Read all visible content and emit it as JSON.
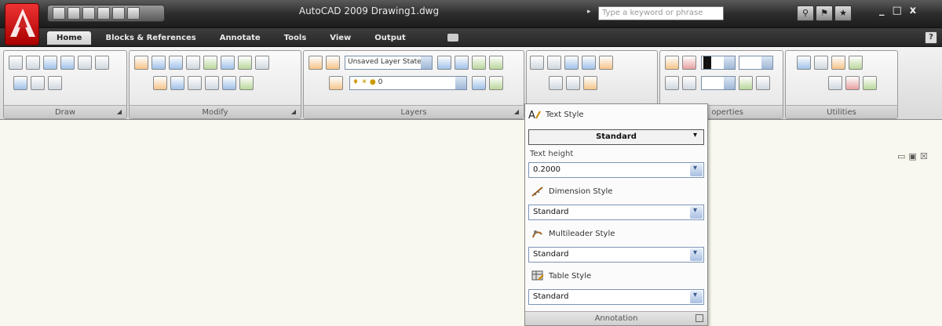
{
  "title_bar": {
    "title": "AutoCAD 2009  Drawing1.dwg",
    "search_placeholder": "Type a keyword or phrase",
    "window_controls": [
      "_",
      "□",
      "x"
    ]
  },
  "tabs": [
    {
      "label": "Home",
      "active": true
    },
    {
      "label": "Blocks & References",
      "active": false
    },
    {
      "label": "Annotate",
      "active": false
    },
    {
      "label": "Tools",
      "active": false
    },
    {
      "label": "View",
      "active": false
    },
    {
      "label": "Output",
      "active": false
    }
  ],
  "help_label": "?",
  "panels": {
    "draw": "Draw",
    "modify": "Modify",
    "layers": "Layers",
    "properties": "operties",
    "utilities": "Utilities"
  },
  "layers": {
    "layer_dropdown": "Unsaved Layer State",
    "layer_current": "0"
  },
  "annotation": {
    "text_style_label": "Text Style",
    "text_style_value": "Standard",
    "text_height_label": "Text height",
    "text_height_value": "0.2000",
    "dimension_style_label": "Dimension Style",
    "dimension_style_value": "Standard",
    "multileader_style_label": "Multileader Style",
    "multileader_style_value": "Standard",
    "table_style_label": "Table Style",
    "table_style_value": "Standard",
    "footer": "Annotation"
  },
  "colors": {
    "title_bar": "#2d2d2d",
    "canvas": "#f9f8ee",
    "app_logo": "#cc2222"
  }
}
